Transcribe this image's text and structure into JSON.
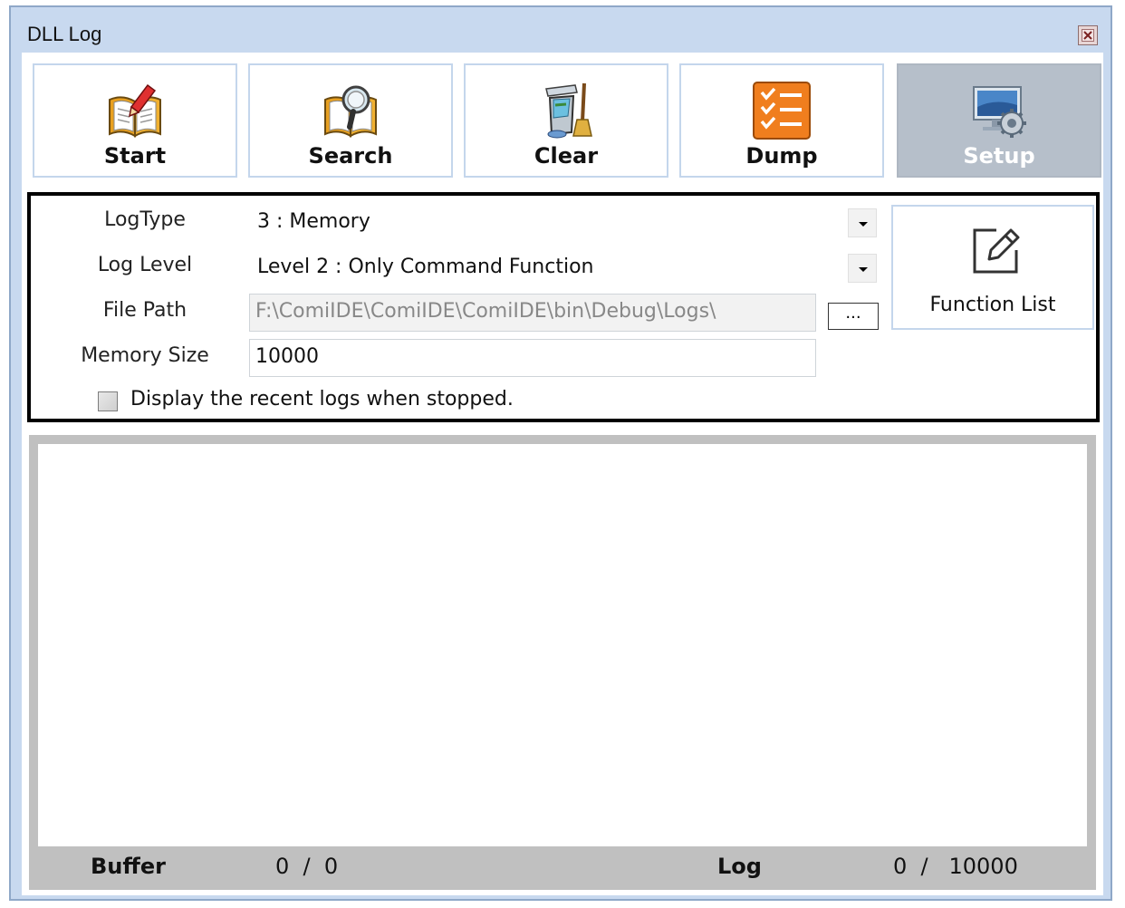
{
  "window": {
    "title": "DLL Log"
  },
  "toolbar": [
    {
      "label": "Start",
      "icon": "book-pencil-icon"
    },
    {
      "label": "Search",
      "icon": "book-magnifier-icon"
    },
    {
      "label": "Clear",
      "icon": "trash-broom-icon"
    },
    {
      "label": "Dump",
      "icon": "checklist-icon"
    },
    {
      "label": "Setup",
      "icon": "monitor-gear-icon",
      "active": true
    }
  ],
  "setup": {
    "log_type": {
      "label": "LogType",
      "value": "3 : Memory"
    },
    "log_level": {
      "label": "Log Level",
      "value": "Level 2 : Only Command Function"
    },
    "file_path": {
      "label": "File Path",
      "value": "F:\\ComiIDE\\ComiIDE\\ComiIDE\\bin\\Debug\\Logs\\",
      "browse_label": "..."
    },
    "memory_size": {
      "label": "Memory Size",
      "value": "10000"
    },
    "recent_logs": {
      "label": "Display the recent logs when stopped.",
      "checked": false
    },
    "function_list": {
      "label": "Function List",
      "icon": "edit-icon"
    }
  },
  "status": {
    "buffer_label": "Buffer",
    "buffer_value": "0  /  0",
    "log_label": "Log",
    "log_value": "0  /   10000"
  },
  "colors": {
    "frame": "#c8d9ef",
    "button_border": "#c4d6ec",
    "active_button": "#b6bfca",
    "dump_orange": "#f07e1e",
    "log_frame": "#c0c0c0"
  }
}
